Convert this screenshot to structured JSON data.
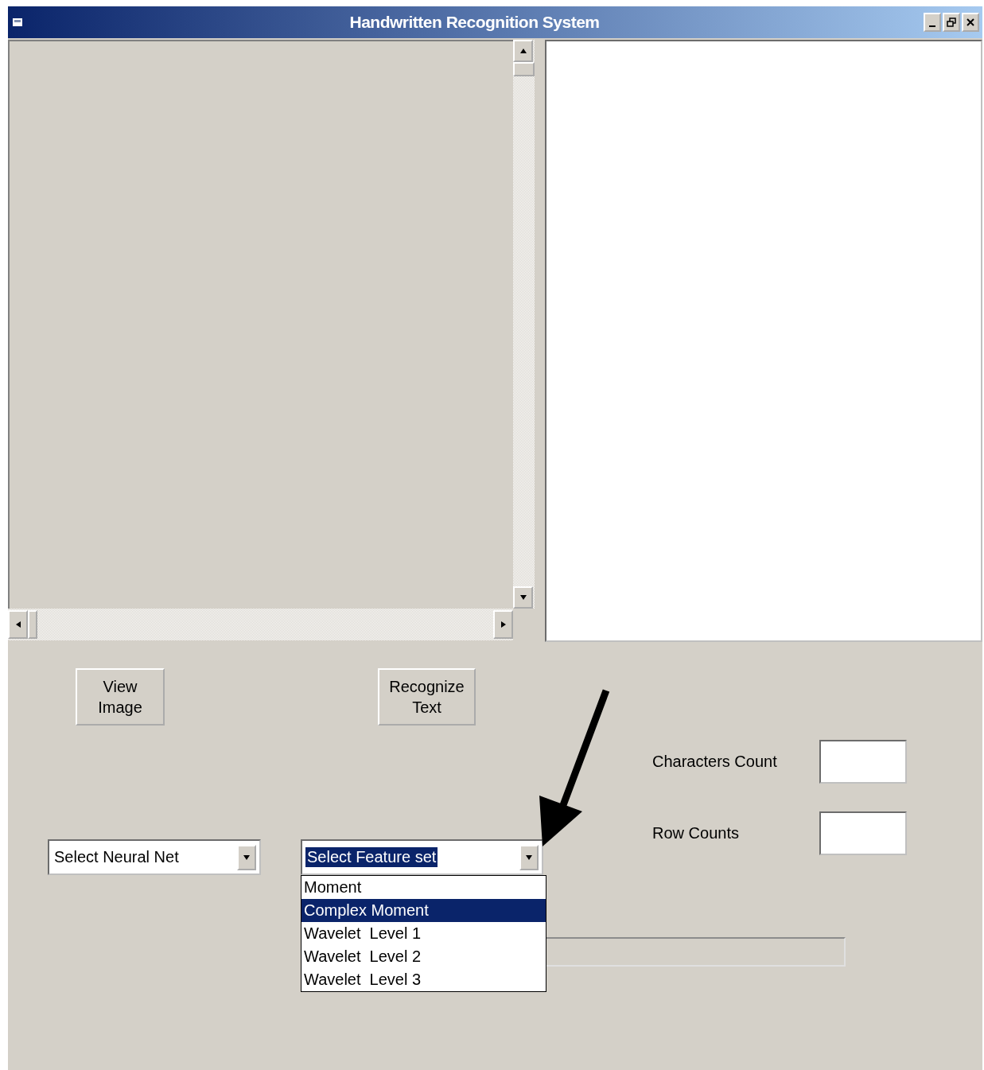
{
  "window": {
    "title": "Handwritten Recognition System"
  },
  "buttons": [
    {
      "label": "View Image"
    },
    {
      "label": "Recognize Text"
    }
  ],
  "counts": [
    {
      "label": "Characters Count"
    },
    {
      "label": "Row Counts"
    }
  ],
  "neural_net_select": {
    "value": "Select Neural Net"
  },
  "feature_select": {
    "value": "Select Feature set",
    "text_selected": true,
    "expanded": true,
    "options": [
      {
        "label": "Moment",
        "selected": false
      },
      {
        "label": "Complex Moment",
        "selected": true
      },
      {
        "label": "Wavelet  Level 1",
        "selected": false
      },
      {
        "label": "Wavelet  Level 2",
        "selected": false
      },
      {
        "label": "Wavelet  Level 3",
        "selected": false
      }
    ]
  },
  "progress_bar": {
    "level": 0
  }
}
